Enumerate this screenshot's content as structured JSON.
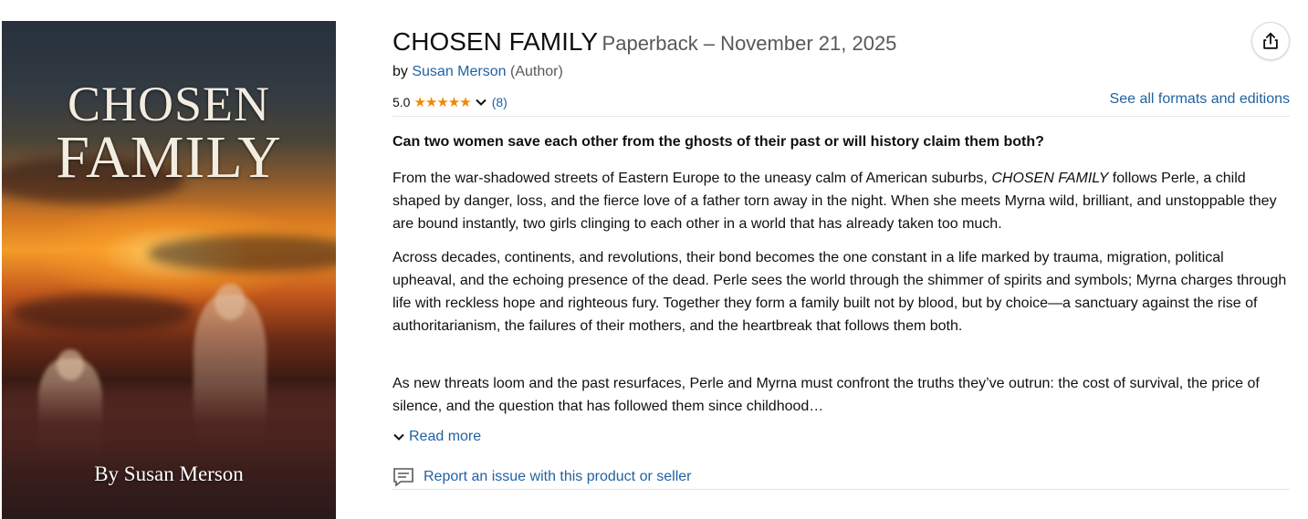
{
  "cover": {
    "title_line1": "CHOSEN",
    "title_line2": "FAMILY",
    "byline": "By Susan Merson"
  },
  "product": {
    "title": "CHOSEN FAMILY",
    "format": "Paperback – November 21, 2025",
    "by_prefix": "by",
    "author": "Susan Merson",
    "author_role": "(Author)",
    "rating_value": "5.0",
    "stars": "★★★★★",
    "rating_count": "(8)",
    "see_all_formats": "See all formats and editions",
    "share_icon": "share-icon"
  },
  "description": {
    "headline": "Can two women save each other from the ghosts of their past or will history claim them both?",
    "p1_before": "From the war-shadowed streets of Eastern Europe to the uneasy calm of American suburbs, ",
    "p1_italic": "CHOSEN FAMILY",
    "p1_after": " follows Perle, a child shaped by danger, loss, and the fierce love of a father torn away in the night. When she meets Myrna wild, brilliant, and unstoppable they are bound instantly, two girls clinging to each other in a world that has already taken too much.",
    "p2": "Across decades, continents, and revolutions, their bond becomes the one constant in a life marked by trauma, migration, political upheaval, and the echoing presence of the dead. Perle sees the world through the shimmer of spirits and symbols; Myrna charges through life with reckless hope and righteous fury. Together they form a family built not by blood, but by choice—a sanctuary against the rise of authoritarianism, the failures of their mothers, and the heartbreak that follows them both.",
    "p3": "As new threats loom and the past resurfaces, Perle and Myrna must confront the truths they’ve outrun: the cost of survival, the price of silence, and the question that has followed them since childhood…",
    "read_more": "Read more"
  },
  "report": {
    "label": "Report an issue with this product or seller"
  },
  "colors": {
    "link": "#2162a1",
    "star": "#f08804",
    "text": "#0f1111",
    "muted": "#565959",
    "divider": "#e3e6e6"
  }
}
